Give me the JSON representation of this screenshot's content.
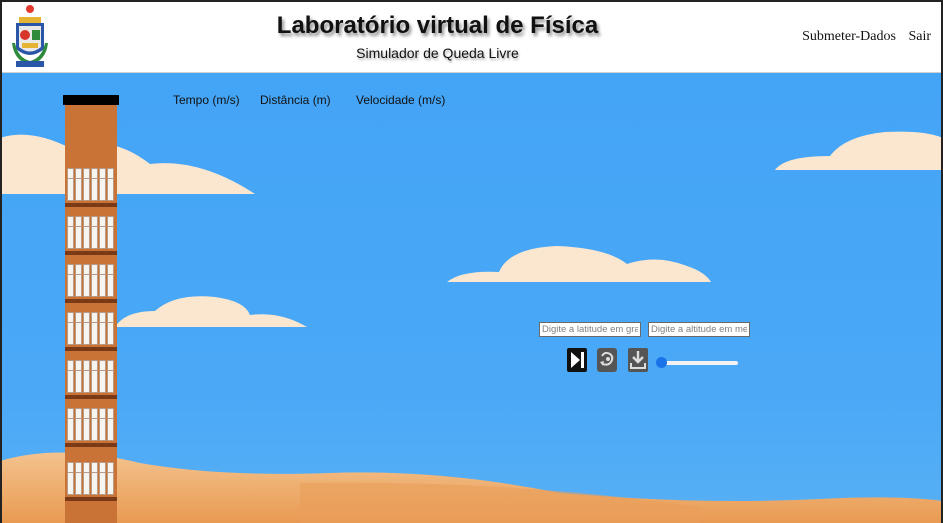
{
  "header": {
    "title": "Laboratório virtual de Físíca",
    "subtitle": "Simulador de Queda Livre",
    "nav": [
      "Submeter-Dados",
      "Sair"
    ]
  },
  "readouts": {
    "time_label": "Tempo (m/s)",
    "distance_label": "Distância (m)",
    "velocity_label": "Velocidade (m/s)"
  },
  "controls": {
    "latitude_placeholder": "Digite a latitude em graus",
    "altitude_placeholder": "Digite a altitude em metros",
    "latitude_value": "",
    "altitude_value": "",
    "icons": [
      "step-forward-icon",
      "reset-icon",
      "download-icon"
    ],
    "slider_value": 0
  },
  "colors": {
    "sky": "#49a6f6",
    "cloud": "#fbe7cf",
    "sand": "#efb170",
    "building": "#c97436",
    "slider_thumb": "#1a73e8"
  }
}
